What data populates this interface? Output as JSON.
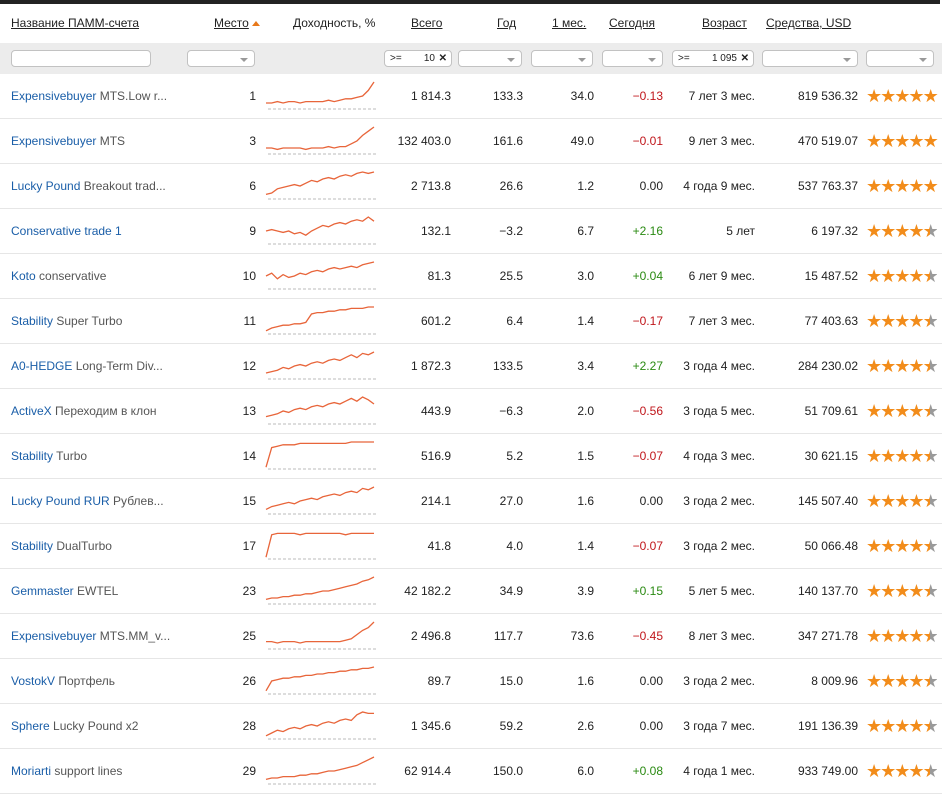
{
  "header": {
    "name": "Название ПАММ-счета",
    "place": "Место",
    "yield": "Доходность, %",
    "total": "Всего",
    "year": "Год",
    "month": "1 мес.",
    "today": "Сегодня",
    "age": "Возраст",
    "funds": "Средства, USD"
  },
  "filters": {
    "total_op": ">=",
    "total_value": "10",
    "age_op": ">=",
    "age_value": "1 095",
    "clear_glyph": "✕"
  },
  "rows": [
    {
      "acc": "Expensivebuyer",
      "sub": " MTS.Low r...",
      "place": "1",
      "total": "1 814.3",
      "year": "133.3",
      "month": "34.0",
      "today": "−0.13",
      "today_sign": "neg",
      "age": "7 лет 3 мес.",
      "funds": "819 536.32",
      "rating": 5,
      "spark": [
        5,
        5,
        6,
        5,
        6,
        6,
        5,
        6,
        6,
        6,
        6,
        7,
        6,
        7,
        8,
        8,
        9,
        10,
        14,
        20
      ]
    },
    {
      "acc": "Expensivebuyer",
      "sub": " MTS",
      "place": "3",
      "total": "132 403.0",
      "year": "161.6",
      "month": "49.0",
      "today": "−0.01",
      "today_sign": "neg",
      "age": "9 лет 3 мес.",
      "funds": "470 519.07",
      "rating": 5,
      "spark": [
        5,
        5,
        4,
        5,
        5,
        5,
        5,
        4,
        5,
        5,
        5,
        6,
        5,
        6,
        6,
        8,
        10,
        14,
        17,
        20
      ]
    },
    {
      "acc": "Lucky Pound",
      "sub": " Breakout trad...",
      "place": "6",
      "total": "2 713.8",
      "year": "26.6",
      "month": "1.2",
      "today": "0.00",
      "today_sign": "",
      "age": "4 года 9 мес.",
      "funds": "537 763.37",
      "rating": 5,
      "spark": [
        4,
        5,
        8,
        9,
        10,
        11,
        10,
        12,
        14,
        13,
        15,
        16,
        15,
        17,
        18,
        17,
        19,
        20,
        19,
        20
      ]
    },
    {
      "acc": "Conservative trade 1",
      "sub": "",
      "place": "9",
      "total": "132.1",
      "year": "−3.2",
      "month": "6.7",
      "today": "+2.16",
      "today_sign": "pos",
      "age": "5 лет",
      "funds": "6 197.32",
      "rating": 4.5,
      "spark": [
        10,
        11,
        10,
        9,
        10,
        8,
        9,
        7,
        10,
        12,
        14,
        13,
        15,
        16,
        15,
        17,
        18,
        17,
        20,
        17
      ]
    },
    {
      "acc": "Koto",
      "sub": " conservative",
      "place": "10",
      "total": "81.3",
      "year": "25.5",
      "month": "3.0",
      "today": "+0.04",
      "today_sign": "pos",
      "age": "6 лет 9 мес.",
      "funds": "15 487.52",
      "rating": 4.5,
      "spark": [
        10,
        12,
        8,
        11,
        9,
        10,
        12,
        11,
        13,
        14,
        13,
        15,
        16,
        15,
        16,
        17,
        16,
        18,
        19,
        20
      ]
    },
    {
      "acc": "Stability",
      "sub": " Super Turbo",
      "place": "11",
      "total": "601.2",
      "year": "6.4",
      "month": "1.4",
      "today": "−0.17",
      "today_sign": "neg",
      "age": "7 лет 3 мес.",
      "funds": "77 403.63",
      "rating": 4.5,
      "spark": [
        3,
        5,
        6,
        7,
        7,
        8,
        8,
        9,
        15,
        16,
        16,
        17,
        17,
        18,
        18,
        19,
        19,
        19,
        20,
        20
      ]
    },
    {
      "acc": "A0-HEDGE",
      "sub": " Long-Term Div...",
      "place": "12",
      "total": "1 872.3",
      "year": "133.5",
      "month": "3.4",
      "today": "+2.27",
      "today_sign": "pos",
      "age": "3 года 4 мес.",
      "funds": "284 230.02",
      "rating": 4.5,
      "spark": [
        5,
        6,
        7,
        9,
        8,
        10,
        11,
        10,
        12,
        13,
        12,
        14,
        15,
        14,
        16,
        18,
        16,
        19,
        18,
        20
      ]
    },
    {
      "acc": "ActiveX",
      "sub": " Переходим в клон",
      "place": "13",
      "total": "443.9",
      "year": "−6.3",
      "month": "2.0",
      "today": "−0.56",
      "today_sign": "neg",
      "age": "3 года 5 мес.",
      "funds": "51 709.61",
      "rating": 4.5,
      "spark": [
        6,
        7,
        8,
        10,
        9,
        11,
        12,
        11,
        13,
        14,
        13,
        15,
        16,
        15,
        17,
        19,
        17,
        20,
        18,
        15
      ]
    },
    {
      "acc": "Stability",
      "sub": " Turbo",
      "place": "14",
      "total": "516.9",
      "year": "5.2",
      "month": "1.5",
      "today": "−0.07",
      "today_sign": "neg",
      "age": "4 года 3 мес.",
      "funds": "30 621.15",
      "rating": 4.5,
      "spark": [
        2,
        16,
        17,
        18,
        18,
        18,
        19,
        19,
        19,
        19,
        19,
        19,
        19,
        19,
        19,
        20,
        20,
        20,
        20,
        20
      ]
    },
    {
      "acc": "Lucky Pound RUR",
      "sub": " Рублев...",
      "place": "15",
      "total": "214.1",
      "year": "27.0",
      "month": "1.6",
      "today": "0.00",
      "today_sign": "",
      "age": "3 года 2 мес.",
      "funds": "145 507.40",
      "rating": 4.5,
      "spark": [
        4,
        6,
        7,
        8,
        9,
        8,
        10,
        11,
        12,
        11,
        13,
        14,
        15,
        14,
        16,
        17,
        16,
        19,
        18,
        20
      ]
    },
    {
      "acc": "Stability",
      "sub": " DualTurbo",
      "place": "17",
      "total": "41.8",
      "year": "4.0",
      "month": "1.4",
      "today": "−0.07",
      "today_sign": "neg",
      "age": "3 года 2 мес.",
      "funds": "50 066.48",
      "rating": 4.5,
      "spark": [
        2,
        18,
        19,
        19,
        19,
        19,
        18,
        19,
        19,
        19,
        19,
        19,
        19,
        19,
        18,
        19,
        19,
        19,
        19,
        19
      ]
    },
    {
      "acc": "Gemmaster",
      "sub": " EWTEL",
      "place": "23",
      "total": "42 182.2",
      "year": "34.9",
      "month": "3.9",
      "today": "+0.15",
      "today_sign": "pos",
      "age": "5 лет 5 мес.",
      "funds": "140 137.70",
      "rating": 4.5,
      "spark": [
        4,
        5,
        5,
        6,
        6,
        7,
        7,
        8,
        8,
        9,
        10,
        10,
        11,
        12,
        13,
        14,
        15,
        17,
        18,
        20
      ]
    },
    {
      "acc": "Expensivebuyer",
      "sub": " MTS.MM_v...",
      "place": "25",
      "total": "2 496.8",
      "year": "117.7",
      "month": "73.6",
      "today": "−0.45",
      "today_sign": "neg",
      "age": "8 лет 3 мес.",
      "funds": "347 271.78",
      "rating": 4.5,
      "spark": [
        6,
        6,
        5,
        6,
        6,
        6,
        5,
        6,
        6,
        6,
        6,
        6,
        6,
        6,
        7,
        8,
        11,
        14,
        16,
        20
      ]
    },
    {
      "acc": "VostokV",
      "sub": " Портфель",
      "place": "26",
      "total": "89.7",
      "year": "15.0",
      "month": "1.6",
      "today": "0.00",
      "today_sign": "",
      "age": "3 года 2 мес.",
      "funds": "8 009.96",
      "rating": 4.5,
      "spark": [
        3,
        10,
        11,
        12,
        12,
        13,
        13,
        14,
        14,
        15,
        15,
        16,
        16,
        17,
        17,
        18,
        18,
        19,
        19,
        20
      ]
    },
    {
      "acc": "Sphere",
      "sub": " Lucky Pound x2",
      "place": "28",
      "total": "1 345.6",
      "year": "59.2",
      "month": "2.6",
      "today": "0.00",
      "today_sign": "",
      "age": "3 года 7 мес.",
      "funds": "191 136.39",
      "rating": 4.5,
      "spark": [
        3,
        5,
        7,
        6,
        8,
        9,
        8,
        10,
        11,
        10,
        12,
        13,
        12,
        14,
        15,
        14,
        18,
        20,
        19,
        19
      ]
    },
    {
      "acc": "Moriarti",
      "sub": " support lines",
      "place": "29",
      "total": "62 914.4",
      "year": "150.0",
      "month": "6.0",
      "today": "+0.08",
      "today_sign": "pos",
      "age": "4 года 1 мес.",
      "funds": "933 749.00",
      "rating": 4.5,
      "spark": [
        4,
        5,
        5,
        6,
        6,
        6,
        7,
        7,
        8,
        8,
        9,
        10,
        10,
        11,
        12,
        13,
        14,
        16,
        18,
        20
      ]
    }
  ],
  "colors": {
    "link": "#1a5ea8",
    "negative": "#c0161b",
    "positive": "#2a8a12",
    "spark": "#e8653a",
    "star": "#f28c1a",
    "sort_arrow": "#e8781a"
  }
}
